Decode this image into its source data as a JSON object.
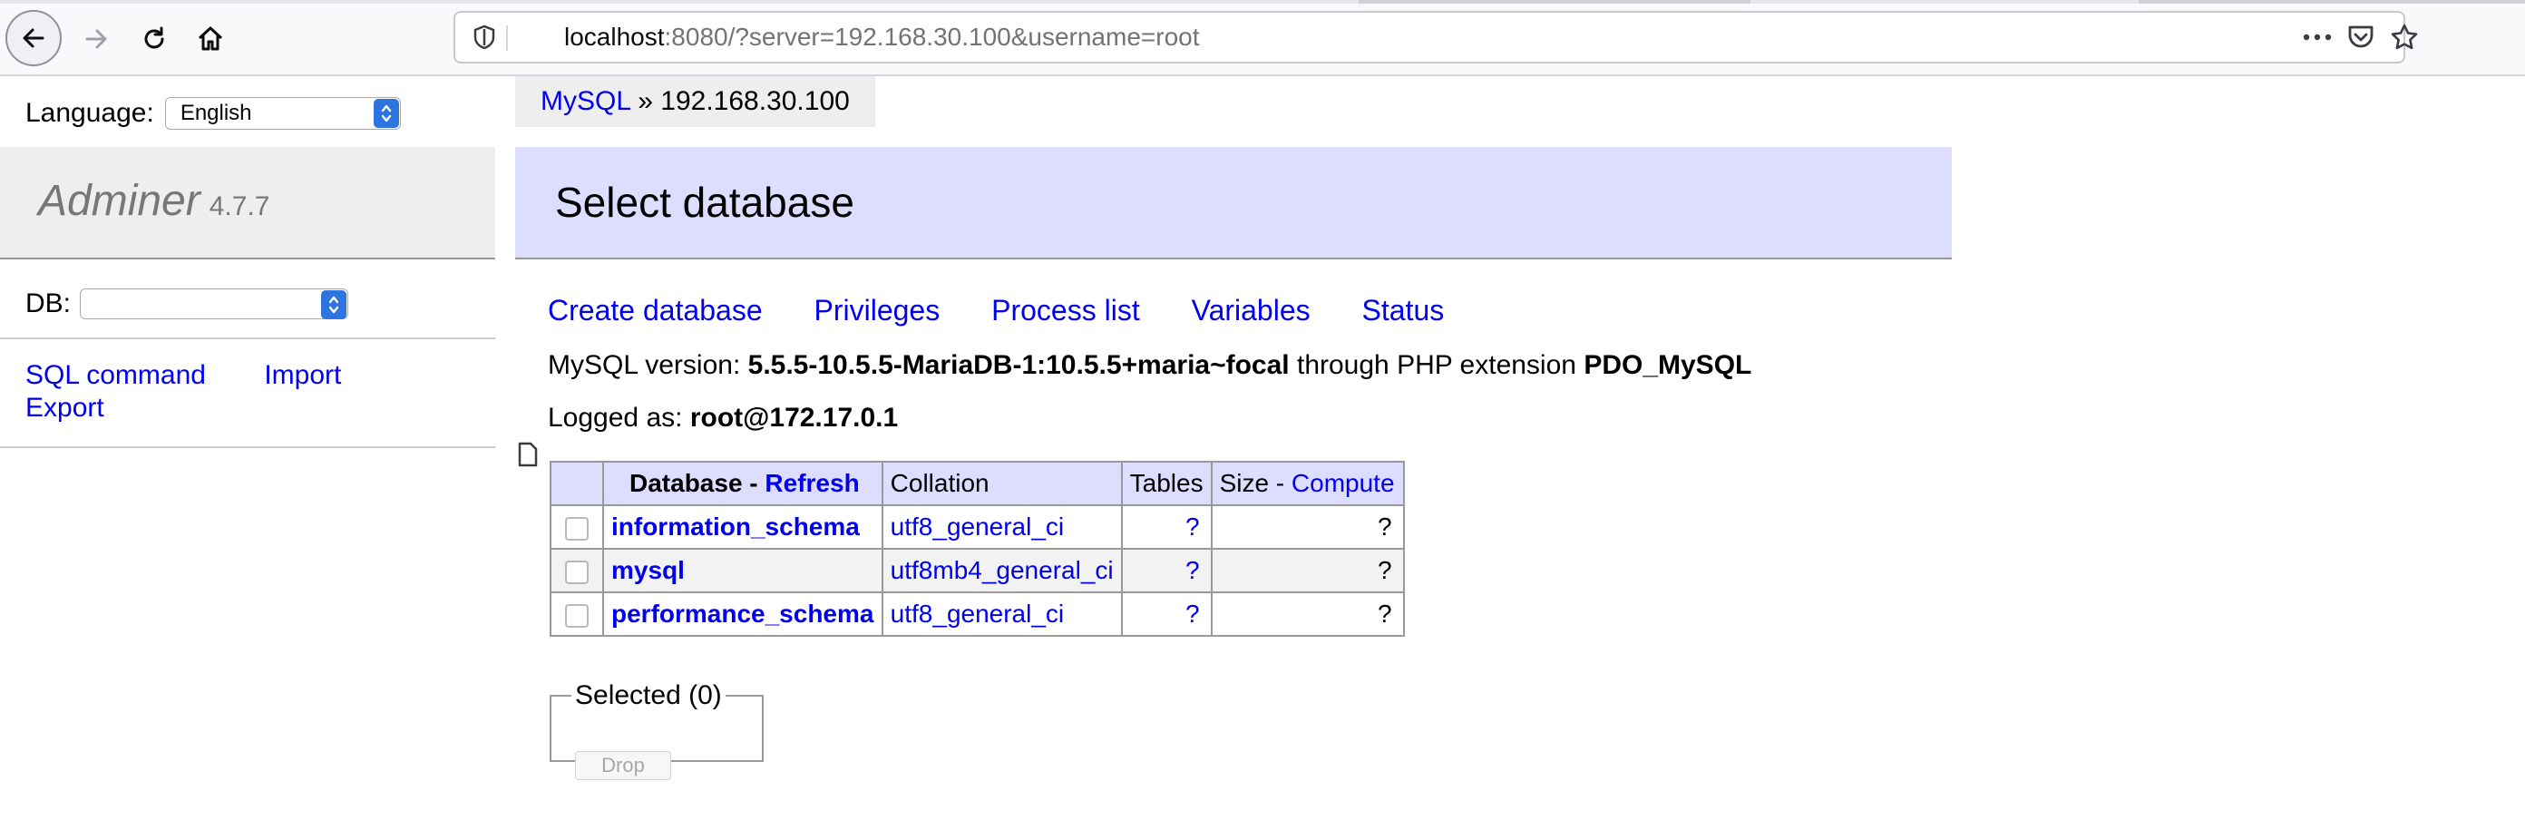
{
  "browser": {
    "url_host": "localhost",
    "url_rest": ":8080/?server=192.168.30.100&username=root",
    "icons": [
      "back-arrow-icon",
      "forward-arrow-icon",
      "reload-icon",
      "home-icon",
      "shield-icon",
      "page-icon",
      "more-icon",
      "pocket-icon",
      "star-icon"
    ]
  },
  "sidebar": {
    "language_label": "Language:",
    "language_value": "English",
    "logo_name": "Adminer",
    "logo_version": "4.7.7",
    "db_label": "DB:",
    "db_value": "",
    "links": {
      "sql_command": "SQL command",
      "import": "Import",
      "export": "Export"
    }
  },
  "content": {
    "breadcrumb": {
      "root": "MySQL",
      "sep": "»",
      "server": "192.168.30.100"
    },
    "title": "Select database",
    "menu": {
      "create_database": "Create database",
      "privileges": "Privileges",
      "process_list": "Process list",
      "variables": "Variables",
      "status": "Status"
    },
    "version": {
      "label": "MySQL version:",
      "value": "5.5.5-10.5.5-MariaDB-1:10.5.5+maria~focal",
      "through": "through PHP extension",
      "extension": "PDO_MySQL"
    },
    "logged": {
      "label": "Logged as:",
      "value": "root@172.17.0.1"
    },
    "table": {
      "headers": {
        "database": "Database",
        "dash1": " - ",
        "refresh": "Refresh",
        "collation": "Collation",
        "tables": "Tables",
        "size": "Size",
        "dash2": " - ",
        "compute": "Compute"
      },
      "rows": [
        {
          "name": "information_schema",
          "collation": "utf8_general_ci",
          "tables": "?",
          "size": "?"
        },
        {
          "name": "mysql",
          "collation": "utf8mb4_general_ci",
          "tables": "?",
          "size": "?"
        },
        {
          "name": "performance_schema",
          "collation": "utf8_general_ci",
          "tables": "?",
          "size": "?"
        }
      ]
    },
    "selected_legend": "Selected (0)",
    "drop_label": "Drop"
  },
  "colors": {
    "link": "#0000ee",
    "header_band": "#ddddff",
    "sidebar_logo_bg": "#eeeeee",
    "select_arrow": "#2d74e0"
  }
}
